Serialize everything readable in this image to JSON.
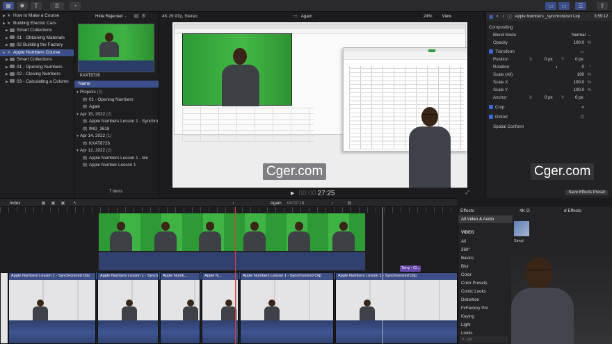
{
  "topbar": {
    "timecode": "3:59:12"
  },
  "library": {
    "items": [
      {
        "label": "How to Make a Course",
        "level": 0,
        "type": "star"
      },
      {
        "label": "Building Electric Cars",
        "level": 0,
        "type": "star"
      },
      {
        "label": "Smart Collections",
        "level": 1,
        "type": "folder"
      },
      {
        "label": "01 - Obtaining Materials",
        "level": 1,
        "type": "folder"
      },
      {
        "label": "02 Building the Factory",
        "level": 1,
        "type": "folder"
      },
      {
        "label": "Apple Numbers Course",
        "level": 0,
        "type": "star",
        "selected": true
      },
      {
        "label": "Smart Collections",
        "level": 1,
        "type": "folder"
      },
      {
        "label": "01 - Opening Numbers",
        "level": 1,
        "type": "folder"
      },
      {
        "label": "02 - Closing Numbers",
        "level": 1,
        "type": "folder"
      },
      {
        "label": "03 - Calculating a Column",
        "level": 1,
        "type": "folder"
      }
    ]
  },
  "browser": {
    "filter": "Hide Rejected",
    "thumb_label": "KXAT8726",
    "column_header": "Name",
    "groups": [
      {
        "label": "Projects",
        "count": "(2)",
        "items": [
          "01 - Opening Numbers",
          "Again"
        ]
      },
      {
        "label": "Apr 15, 2022",
        "count": "(2)",
        "items": [
          "Apple Numbers Lesson 1 - Synchro",
          "IMG_3618"
        ]
      },
      {
        "label": "Apr 14, 2022",
        "count": "(1)",
        "items": [
          "KXAT8726"
        ]
      },
      {
        "label": "Apr 12, 2022",
        "count": "(2)",
        "items": [
          "Apple Numbers Lesson 1 - Me",
          "Apple Number Lesson 1"
        ]
      }
    ],
    "footer": "7 items"
  },
  "viewer": {
    "format": "4K 29.97p, Stereo",
    "title": "Again",
    "zoom": "24%",
    "view_label": "View",
    "timecode_dim": "00:00",
    "timecode": "27:25",
    "watermark": "Cger.com"
  },
  "inspector": {
    "clip_name": "Apple Numbers _synchronized Clip",
    "sections": {
      "compositing": "Compositing",
      "blend_mode_label": "Blend Mode",
      "blend_mode_value": "Normal",
      "opacity_label": "Opacity",
      "opacity_value": "100.0",
      "transform": "Transform",
      "position_label": "Position",
      "position_x": "0 px",
      "position_y": "0 px",
      "rotation_label": "Rotation",
      "rotation_value": "0",
      "scale_all_label": "Scale (All)",
      "scale_all_value": "100",
      "scale_x_label": "Scale X",
      "scale_x_value": "100.0",
      "scale_y_label": "Scale Y",
      "scale_y_value": "100.0",
      "anchor_label": "Anchor",
      "anchor_x": "0 px",
      "anchor_y": "0 px",
      "crop": "Crop",
      "distort": "Distort",
      "spatial_conform": "Spatial Conform"
    },
    "save_preset": "Save Effects Preset",
    "watermark": "Cger.com"
  },
  "timeline_toolbar": {
    "index": "Index",
    "project": "Again",
    "duration": "04:07:18"
  },
  "timeline": {
    "connected_clip": "Terry - Cl...",
    "primary_clips": [
      "Apple Numbers Lesson 1 - Synchronized Clip",
      "Apple Numbers Lesson 1 - Synchronized Clip",
      "Apple Numb...",
      "Apple N...",
      "Apple Numbers Lesson 1 - Synchronized Clip",
      "Apple Numbers Lesson 1 - Synchronized Clip"
    ]
  },
  "effects": {
    "title": "Effects",
    "category_header": "All Video & Audio",
    "browser_title": "4K O",
    "preset_label": "d Effects",
    "thumb_label": "Simpl",
    "section": "VIDEO",
    "categories": [
      "All",
      "360°",
      "Basics",
      "Blur",
      "Color",
      "Color Presets",
      "Comic Looks",
      "Distortion",
      "FxFactory Pro",
      "Keying",
      "Light",
      "Looks"
    ],
    "search_placeholder": "Ion"
  },
  "colors": {
    "accent": "#3b4f8a",
    "green_screen": "#2f9e3a",
    "selection": "#3a6ad8",
    "playhead": "#e23c3c"
  }
}
